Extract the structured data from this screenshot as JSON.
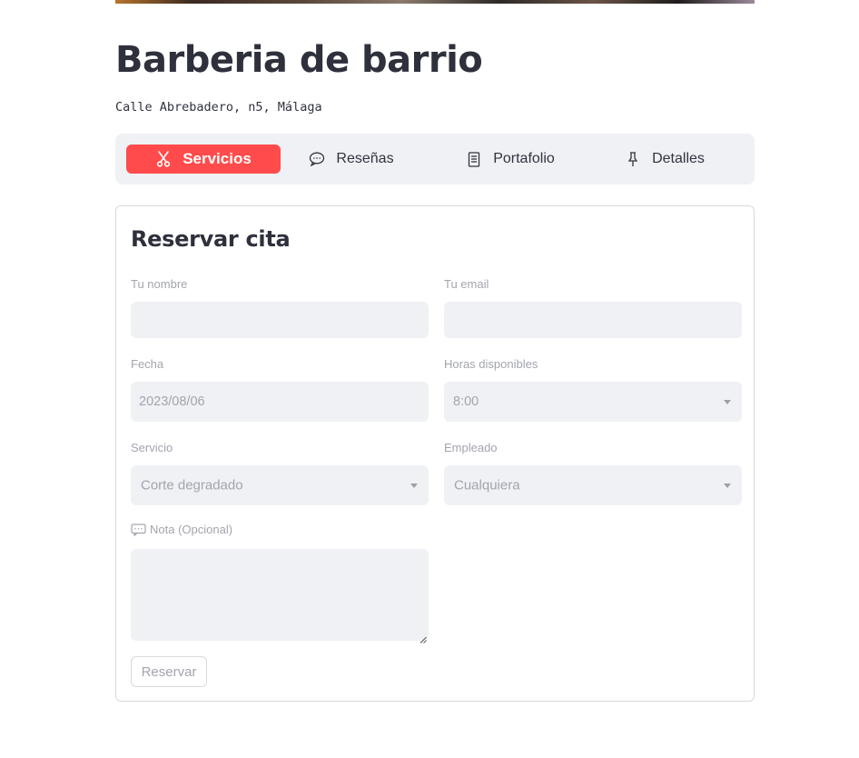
{
  "header": {
    "title": "Barberia de barrio",
    "address": "Calle Abrebadero, n5, Málaga"
  },
  "tabs": [
    {
      "label": "Servicios",
      "icon": "scissors-icon",
      "active": true
    },
    {
      "label": "Reseñas",
      "icon": "speech-bubble-icon",
      "active": false
    },
    {
      "label": "Portafolio",
      "icon": "document-icon",
      "active": false
    },
    {
      "label": "Detalles",
      "icon": "pushpin-icon",
      "active": false
    }
  ],
  "booking": {
    "title": "Reservar cita",
    "name": {
      "label": "Tu nombre",
      "value": ""
    },
    "email": {
      "label": "Tu email",
      "value": ""
    },
    "date": {
      "label": "Fecha",
      "value": "2023/08/06"
    },
    "hours": {
      "label": "Horas disponibles",
      "value": "8:00"
    },
    "service": {
      "label": "Servicio",
      "value": "Corte degradado"
    },
    "employee": {
      "label": "Empleado",
      "value": "Cualquiera"
    },
    "note": {
      "label": "Nota (Opcional)",
      "value": "",
      "icon": "speech-bubble-icon"
    },
    "submit_label": "Reservar"
  },
  "colors": {
    "accent": "#ff4b4b",
    "input_bg": "#eff1f5",
    "muted_text": "#a3a5ae"
  }
}
